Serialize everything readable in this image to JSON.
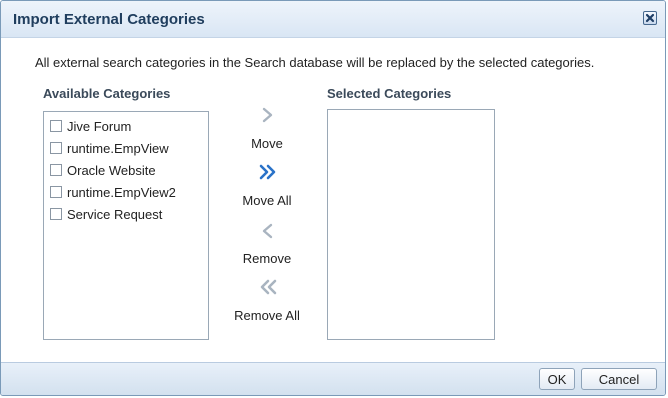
{
  "dialog": {
    "title": "Import External Categories",
    "description": "All external search categories in the Search database will be replaced by the selected categories."
  },
  "available": {
    "heading": "Available Categories",
    "items": [
      "Jive Forum",
      "runtime.EmpView",
      "Oracle Website",
      "runtime.EmpView2",
      "Service Request"
    ]
  },
  "selected": {
    "heading": "Selected Categories",
    "items": []
  },
  "shuttle": {
    "move": "Move",
    "move_all": "Move All",
    "remove": "Remove",
    "remove_all": "Remove All"
  },
  "footer": {
    "ok": "OK",
    "cancel": "Cancel"
  },
  "colors": {
    "active_arrow": "#2a72c8",
    "inactive_arrow": "#a9b4c0"
  }
}
